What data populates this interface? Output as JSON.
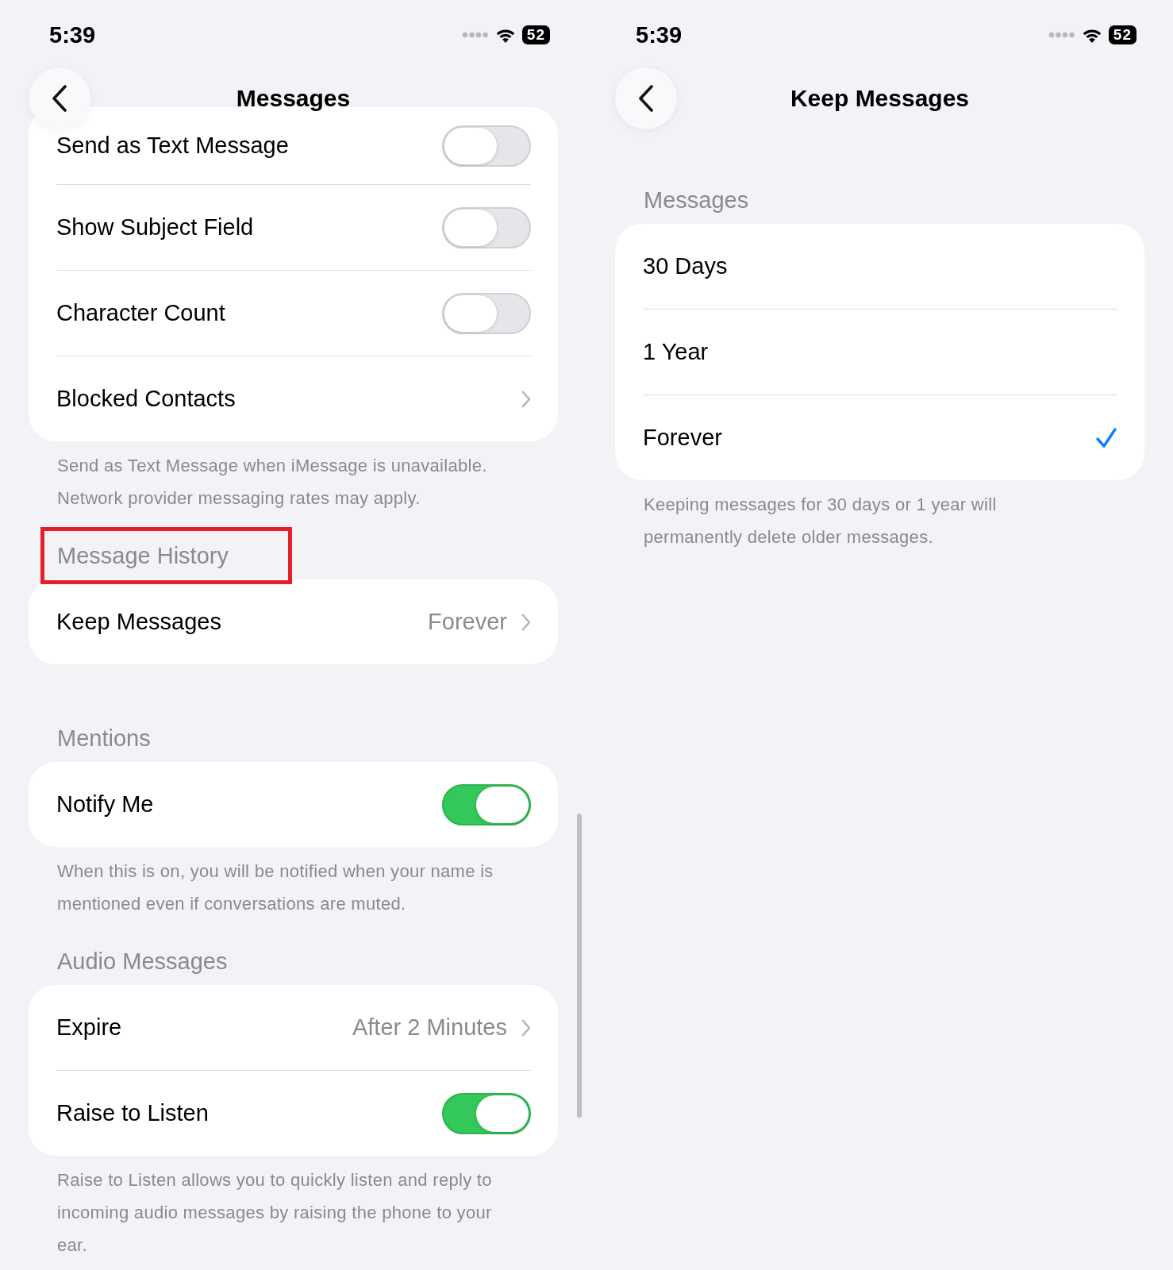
{
  "panels": [
    {
      "status_bar": {
        "time": "5:39",
        "battery": "52"
      },
      "nav": {
        "title": "Messages"
      },
      "scrollbar": true,
      "sections": [
        {
          "rows": [
            {
              "kind": "toggle",
              "label": "Send as Text Message",
              "on": false
            },
            {
              "kind": "toggle",
              "label": "Show Subject Field",
              "on": false
            },
            {
              "kind": "toggle",
              "label": "Character Count",
              "on": false
            },
            {
              "kind": "link",
              "label": "Blocked Contacts"
            }
          ],
          "footer": "Send as Text Message when iMessage is unavailable. Network provider messaging rates may apply."
        },
        {
          "header": "Message History",
          "highlighted": true,
          "rows": [
            {
              "kind": "link",
              "label": "Keep Messages",
              "value": "Forever"
            }
          ]
        },
        {
          "header": "Mentions",
          "rows": [
            {
              "kind": "toggle",
              "label": "Notify Me",
              "on": true
            }
          ],
          "footer": "When this is on, you will be notified when your name is mentioned even if conversations are muted."
        },
        {
          "header": "Audio Messages",
          "rows": [
            {
              "kind": "link",
              "label": "Expire",
              "value": "After 2 Minutes"
            },
            {
              "kind": "toggle",
              "label": "Raise to Listen",
              "on": true
            }
          ],
          "footer": "Raise to Listen allows you to quickly listen and reply to incoming audio messages by raising the phone to your ear."
        }
      ]
    },
    {
      "status_bar": {
        "time": "5:39",
        "battery": "52"
      },
      "nav": {
        "title": "Keep Messages"
      },
      "scrollbar": false,
      "sections": [
        {
          "header": "Messages",
          "rows": [
            {
              "kind": "option",
              "label": "30 Days",
              "selected": false
            },
            {
              "kind": "option",
              "label": "1 Year",
              "selected": false
            },
            {
              "kind": "option",
              "label": "Forever",
              "selected": true
            }
          ],
          "footer": "Keeping messages for 30 days or 1 year will permanently delete older messages."
        }
      ]
    }
  ]
}
